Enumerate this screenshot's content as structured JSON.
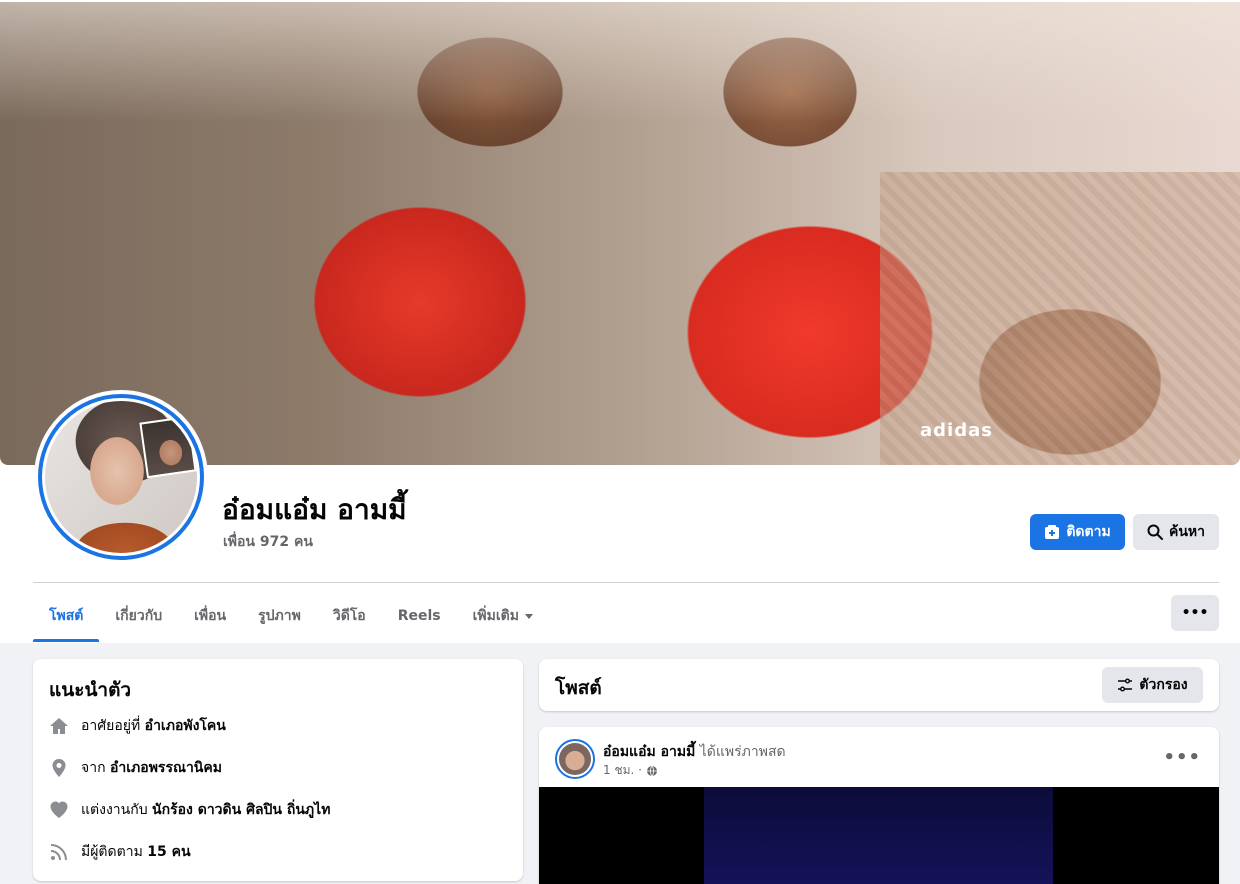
{
  "profile": {
    "name": "อ๋อมแอ๋ม อามมี้",
    "friends": "เพื่อน 972 คน",
    "cover_shirt_text": "adidas"
  },
  "actions": {
    "follow_label": "ติดตาม",
    "search_label": "ค้นหา",
    "more_label": "•••"
  },
  "tabs": [
    {
      "label": "โพสต์",
      "active": true
    },
    {
      "label": "เกี่ยวกับ"
    },
    {
      "label": "เพื่อน"
    },
    {
      "label": "รูปภาพ"
    },
    {
      "label": "วิดีโอ"
    },
    {
      "label": "Reels"
    },
    {
      "label": "เพิ่มเติม"
    }
  ],
  "intro": {
    "title": "แนะนำตัว",
    "lives_prefix": "อาศัยอยู่ที่",
    "lives_value": "อำเภอพังโคน",
    "from_prefix": "จาก",
    "from_value": "อำเภอพรรณานิคม",
    "married_prefix": "แต่งงานกับ",
    "married_value": "นักร้อง ดาวดิน ศิลปิน ถิ่นภูไท",
    "followers_prefix": "มีผู้ติดตาม",
    "followers_value": "15 คน"
  },
  "posts_section": {
    "title": "โพสต์",
    "filter_label": "ตัวกรอง"
  },
  "post": {
    "author": "อ๋อมแอ๋ม อามมี้",
    "action": "ได้แพร่ภาพสด",
    "time": "1 ชม. ·",
    "menu": "•••"
  },
  "colors": {
    "accent": "#1b74e4",
    "page_bg": "#f0f2f5",
    "secondary_text": "#65676b",
    "button_gray": "#e4e6eb"
  },
  "icons": [
    "home-icon",
    "location-pin-icon",
    "heart-icon",
    "rss-icon",
    "search-icon",
    "follow-icon",
    "filter-icon",
    "globe-icon",
    "chevron-down-icon"
  ]
}
